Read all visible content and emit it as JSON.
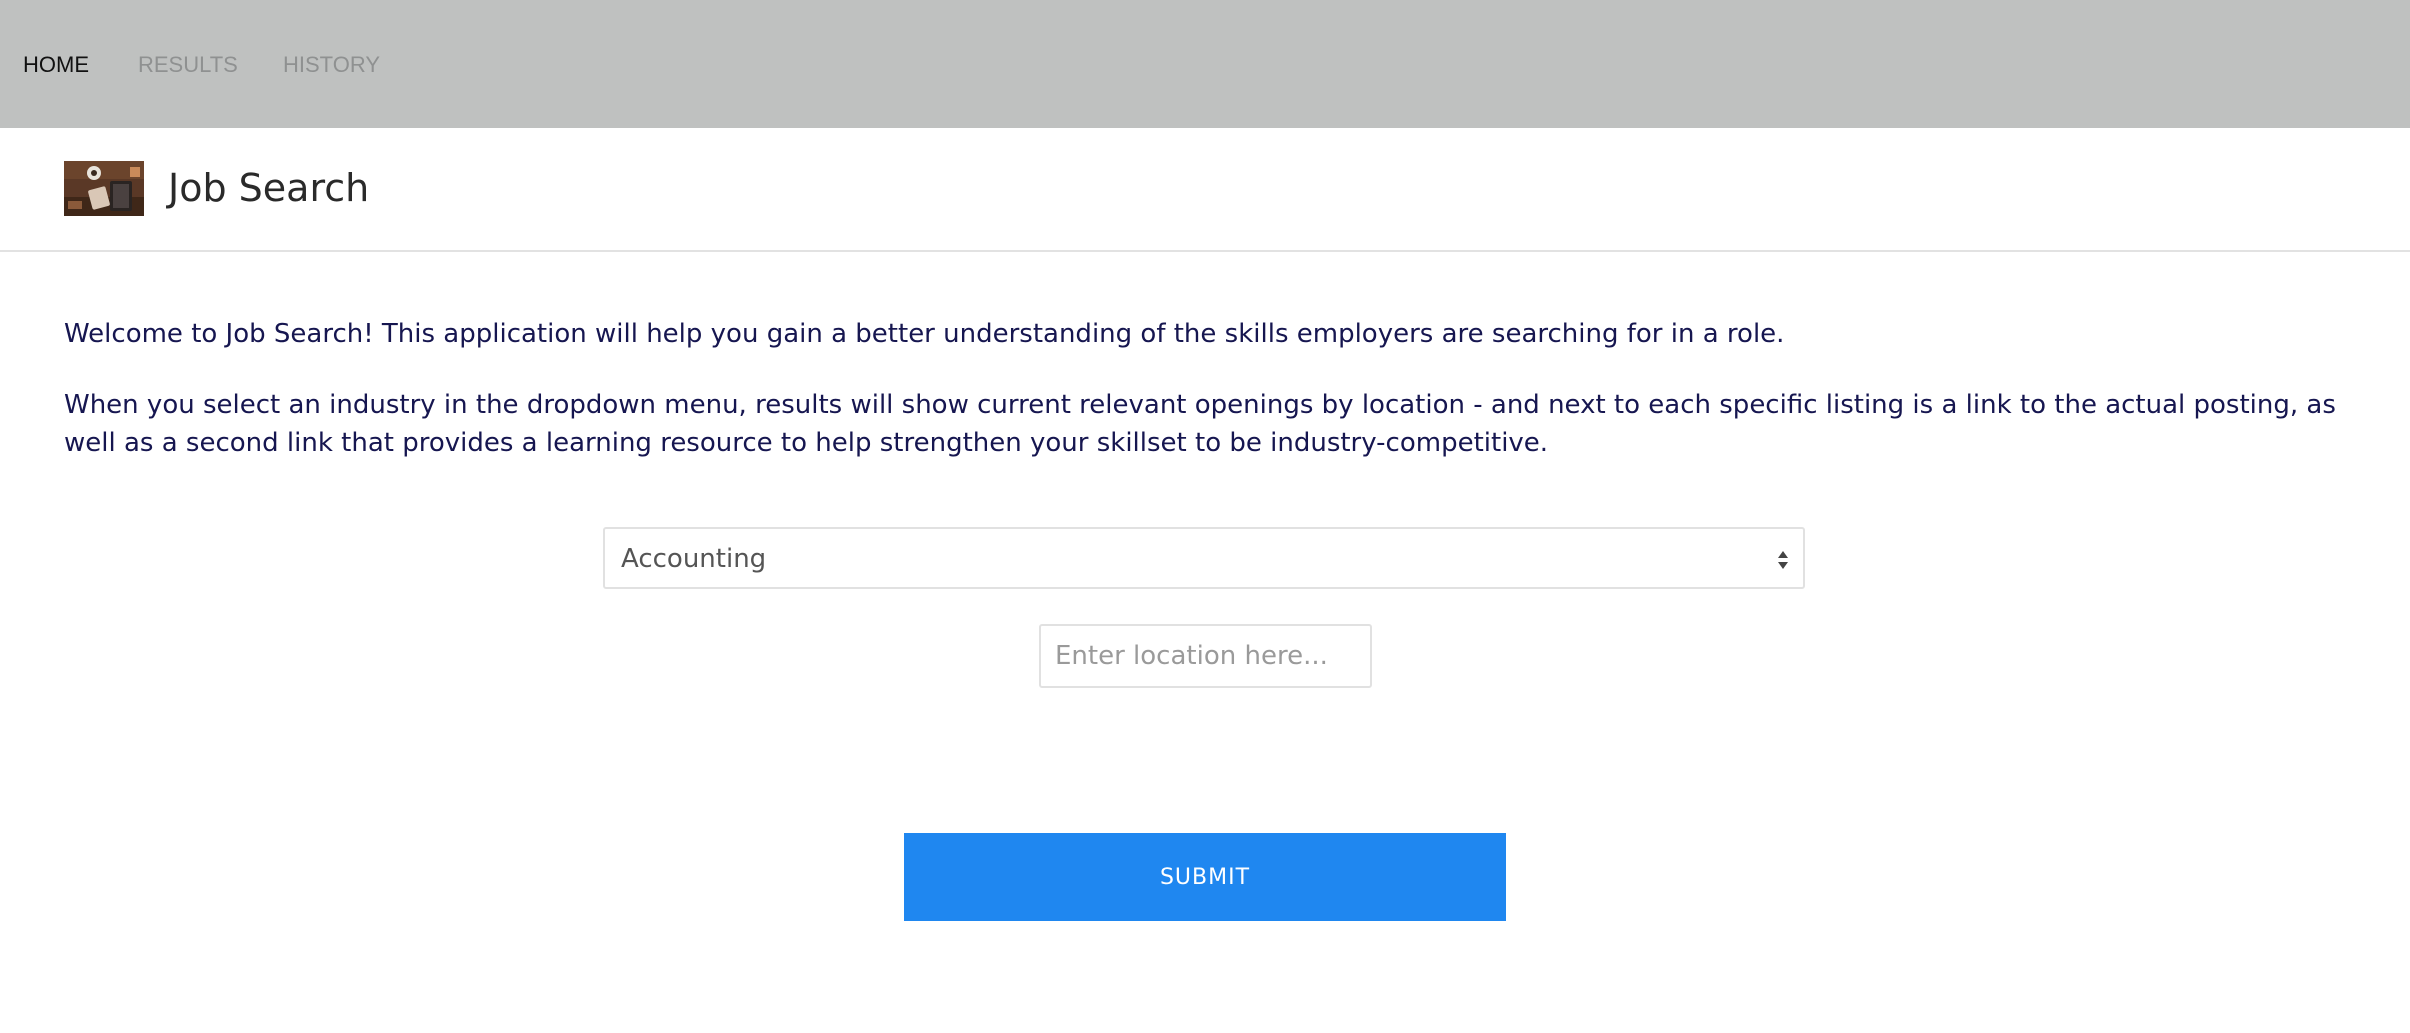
{
  "nav": {
    "items": [
      {
        "label": "HOME",
        "active": true
      },
      {
        "label": "RESULTS",
        "active": false
      },
      {
        "label": "HISTORY",
        "active": false
      }
    ]
  },
  "header": {
    "title": "Job Search",
    "logo_icon": "desk-photo-thumbnail"
  },
  "intro": {
    "paragraph1": "Welcome to Job Search! This application will help you gain a better understanding of the skills employers are searching for in a role.",
    "paragraph2": "When you select an industry in the dropdown menu, results will show current relevant openings by location - and next to each specific listing is a link to the actual posting, as well as a second link that provides a learning resource to help strengthen your skillset to be industry-competitive."
  },
  "form": {
    "industry_selected": "Accounting",
    "location_value": "",
    "location_placeholder": "Enter location here...",
    "submit_label": "SUBMIT"
  },
  "colors": {
    "navbar_bg": "#bfc1c0",
    "text_primary": "#161650",
    "accent": "#1f87f0"
  }
}
